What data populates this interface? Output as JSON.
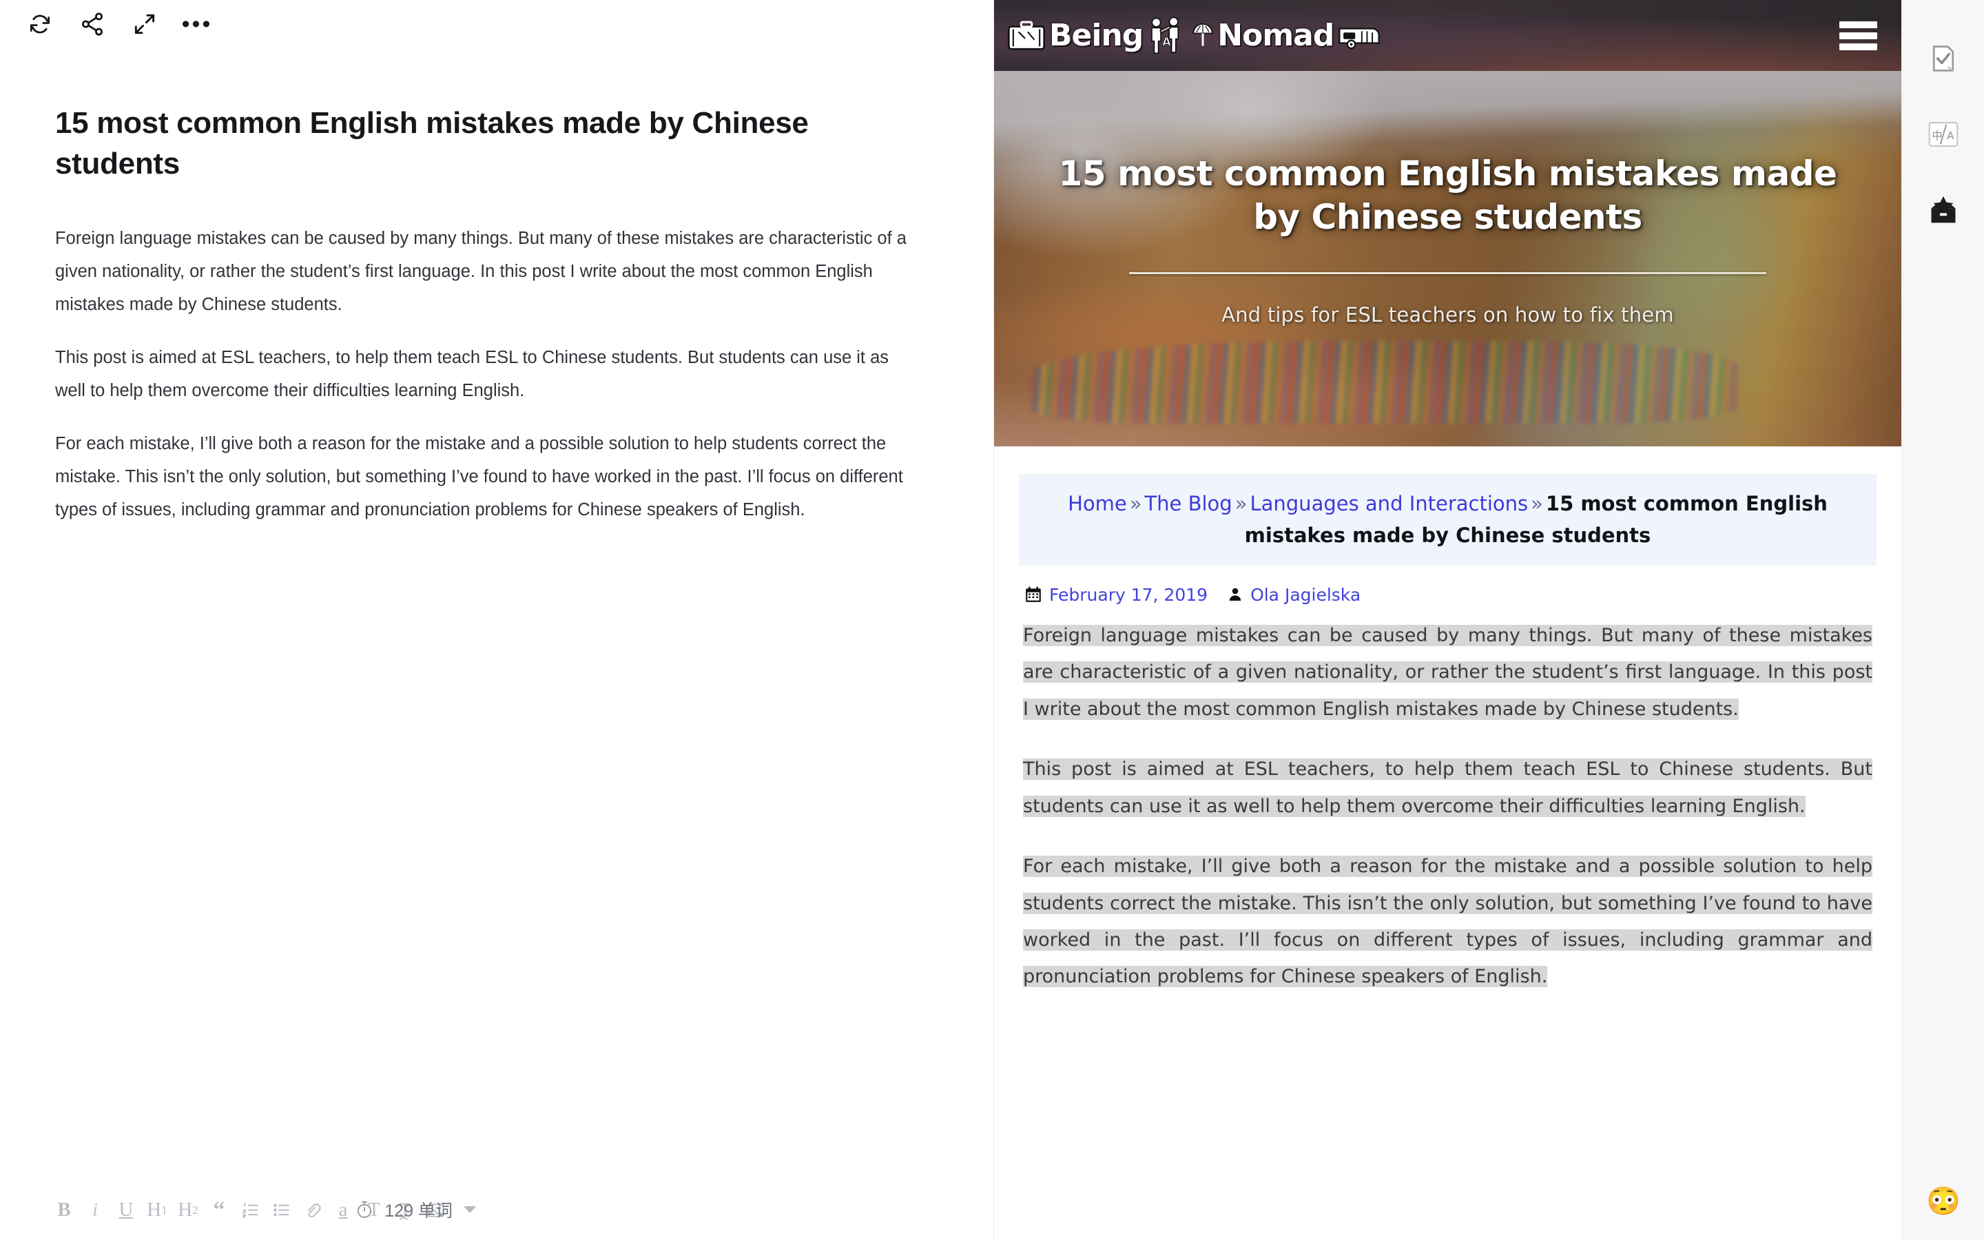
{
  "editor": {
    "toolbar": [
      {
        "name": "sync-icon",
        "label": "Sync"
      },
      {
        "name": "share-icon",
        "label": "Share"
      },
      {
        "name": "fullscreen-icon",
        "label": "Fullscreen"
      },
      {
        "name": "more-options-icon",
        "label": "More"
      }
    ],
    "title": "15 most common English mistakes made by Chinese students",
    "paragraphs": [
      "Foreign language mistakes can be caused by many things. But many of these mistakes are characteristic of a given nationality, or rather the student’s first language. In this post I write about the most common English mistakes made by Chinese students.",
      "This post is aimed at ESL teachers, to help them teach ESL to Chinese students. But students can use it as well to help them overcome their difficulties learning English.",
      "For each mistake, I’ll give both a reason for the mistake and a possible solution to help students correct the mistake. This isn’t the only solution, but something I’ve found to have worked in the past. I’ll focus on different types of issues, including grammar and pronunciation problems for Chinese speakers of English."
    ],
    "format_buttons": [
      {
        "name": "bold-button",
        "label": "B"
      },
      {
        "name": "italic-button",
        "label": "i"
      },
      {
        "name": "underline-button",
        "label": "U"
      },
      {
        "name": "heading-1-button",
        "label": "H",
        "sub": "1"
      },
      {
        "name": "heading-2-button",
        "label": "H",
        "sub": "2"
      },
      {
        "name": "blockquote-button",
        "label": "“"
      },
      {
        "name": "ordered-list-button",
        "label": ""
      },
      {
        "name": "unordered-list-button",
        "label": ""
      },
      {
        "name": "link-button",
        "label": ""
      },
      {
        "name": "highlight-button",
        "label": "a"
      },
      {
        "name": "text-style-button",
        "label": "T"
      },
      {
        "name": "clear-format-button",
        "label": ""
      },
      {
        "name": "insert-image-button",
        "label": ""
      }
    ],
    "word_count": "129 单词",
    "timer_icon": "stopwatch-icon"
  },
  "site": {
    "logo_pre": "Being",
    "logo_mid": "A",
    "logo_post": "Nomad",
    "menu_icon": "hamburger-menu-icon",
    "hero": {
      "title": "15 most common English mistakes made by Chinese students",
      "subtitle": "And tips for ESL teachers on how to fix them"
    },
    "breadcrumb": {
      "items": [
        {
          "label": "Home",
          "link": true
        },
        {
          "label": "The Blog",
          "link": true
        },
        {
          "label": "Languages and Interactions",
          "link": true
        }
      ],
      "separator": "»",
      "current": "15 most common English mistakes made by Chinese students"
    },
    "meta": {
      "date_icon": "calendar-icon",
      "date": "February 17, 2019",
      "author_icon": "user-icon",
      "author": "Ola Jagielska"
    },
    "paragraphs": [
      "Foreign language mistakes can be caused by many things. But many of these mistakes are characteristic of a given nationality, or rather the student’s first language. In this post I write about the most common English mistakes made by Chinese students.",
      "This post is aimed at ESL teachers, to help them teach ESL to Chinese students. But students can use it as well to help them overcome their difficulties learning English.",
      "For each mistake, I’ll give both a reason for the mistake and a possible solution to help students correct the mistake. This isn’t the only solution, but something I’ve found to have worked in the past. I’ll focus on different types of issues, including grammar and pronunciation problems for Chinese speakers of English."
    ]
  },
  "right_rail": {
    "buttons": [
      {
        "name": "proofread-icon",
        "label": "Proofread"
      },
      {
        "name": "translate-icon",
        "label": "Translate",
        "left": "中",
        "right": "A"
      },
      {
        "name": "toolbox-icon",
        "label": "Toolbox"
      }
    ],
    "emoji": "😳"
  },
  "colors": {
    "link": "#3b3bd8",
    "breadcrumb_bg": "#f0f4fd",
    "selection_bg": "#d6d6d6",
    "header_bg": "#2f2d31",
    "rail_bg": "#f7f7f7"
  }
}
